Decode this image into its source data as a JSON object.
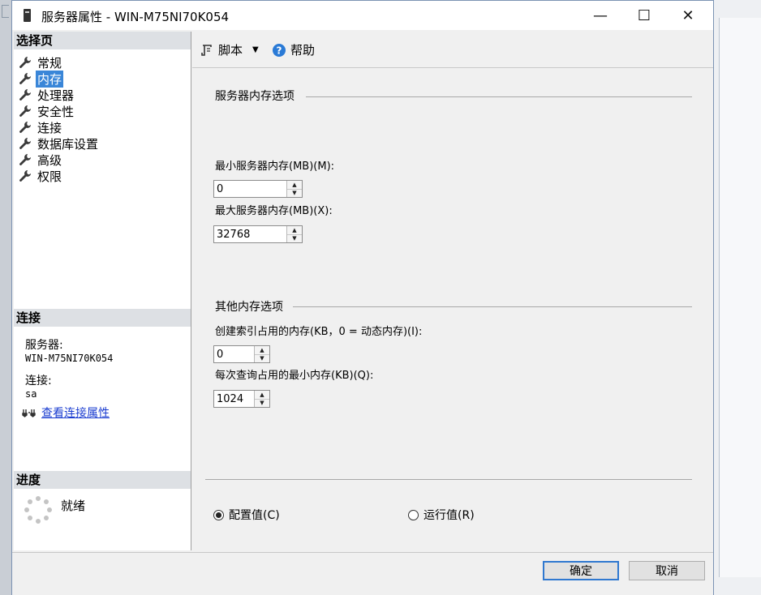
{
  "window": {
    "title": "服务器属性 - WIN-M75NI70K054",
    "minimize_glyph": "—",
    "maximize_glyph": "☐",
    "close_glyph": "✕"
  },
  "left_pane": {
    "select_page_header": "选择页",
    "nav_items": [
      {
        "label": "常规",
        "selected": false
      },
      {
        "label": "内存",
        "selected": true
      },
      {
        "label": "处理器",
        "selected": false
      },
      {
        "label": "安全性",
        "selected": false
      },
      {
        "label": "连接",
        "selected": false
      },
      {
        "label": "数据库设置",
        "selected": false
      },
      {
        "label": "高级",
        "selected": false
      },
      {
        "label": "权限",
        "selected": false
      }
    ],
    "connection_header": "连接",
    "server_label": "服务器:",
    "server_value": "WIN-M75NI70K054",
    "connection_label": "连接:",
    "connection_value": "sa",
    "view_connection_link": "查看连接属性",
    "progress_header": "进度",
    "progress_status": "就绪"
  },
  "toolbar": {
    "script_label": "脚本",
    "help_label": "帮助"
  },
  "content": {
    "server_memory_group": "服务器内存选项",
    "min_memory_label": "最小服务器内存(MB)(M):",
    "min_memory_value": "0",
    "max_memory_label": "最大服务器内存(MB)(X):",
    "max_memory_value": "32768",
    "other_memory_group": "其他内存选项",
    "index_memory_label": "创建索引占用的内存(KB，0 = 动态内存)(I):",
    "index_memory_value": "0",
    "query_memory_label": "每次查询占用的最小内存(KB)(Q):",
    "query_memory_value": "1024",
    "radio_configured": "配置值(C)",
    "radio_running": "运行值(R)",
    "selected_radio": "configured"
  },
  "buttons": {
    "ok": "确定",
    "cancel": "取消"
  },
  "colors": {
    "selection": "#3a86d8",
    "link": "#1a3cd0",
    "default_button_border": "#2f78d0"
  }
}
